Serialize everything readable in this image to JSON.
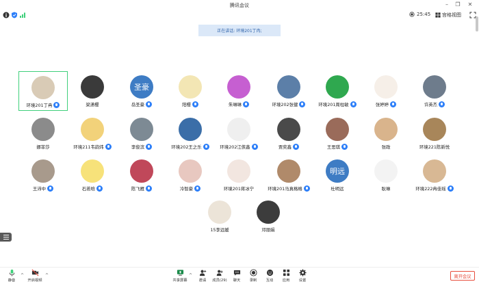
{
  "window": {
    "title": "腾讯会议"
  },
  "topbar": {
    "timer": "25:45",
    "view_label": "宫格视图"
  },
  "speaking": {
    "label": "正在讲话: 环境201丁冉;"
  },
  "colors": {
    "mic": "#2d7ff9",
    "active_border": "#3ecf7a",
    "leave": "#e74c3c",
    "avatar_text_bg": "#3e7cc4"
  },
  "participants": [
    {
      "name": "环境201丁冉",
      "avatar_text": "",
      "avatar_bg": "#d9cbb6",
      "mic": true
    },
    {
      "name": "梁潇樱",
      "avatar_text": "",
      "avatar_bg": "#3a3a3a",
      "mic": false
    },
    {
      "name": "岳圣豪",
      "avatar_text": "圣豪",
      "avatar_bg": "#3e7cc4",
      "mic": true
    },
    {
      "name": "阳樱",
      "avatar_text": "",
      "avatar_bg": "#f3e6b4",
      "mic": true
    },
    {
      "name": "朱琳琳",
      "avatar_text": "",
      "avatar_bg": "#c65fd1",
      "mic": true
    },
    {
      "name": "环境202张健",
      "avatar_text": "",
      "avatar_bg": "#5c7fa8",
      "mic": true
    },
    {
      "name": "环境201周柱敏",
      "avatar_text": "",
      "avatar_bg": "#2fa84f",
      "mic": true
    },
    {
      "name": "张婷婷",
      "avatar_text": "",
      "avatar_bg": "#f6efe8",
      "mic": true
    },
    {
      "name": "许英杰",
      "avatar_text": "",
      "avatar_bg": "#6e7c8c",
      "mic": true
    },
    {
      "name": "娜菲莎",
      "avatar_text": "",
      "avatar_bg": "#8b8b8b",
      "mic": false
    },
    {
      "name": "环境211韦韵炜",
      "avatar_text": "",
      "avatar_bg": "#f2d27a",
      "mic": true
    },
    {
      "name": "李俊滨",
      "avatar_text": "",
      "avatar_bg": "#7d8a94",
      "mic": true
    },
    {
      "name": "环境202王之乐",
      "avatar_text": "",
      "avatar_bg": "#3b6ea8",
      "mic": true
    },
    {
      "name": "环境202江俠鑫",
      "avatar_text": "",
      "avatar_bg": "#efefef",
      "mic": true
    },
    {
      "name": "贾奕鑫",
      "avatar_text": "",
      "avatar_bg": "#4a4a4a",
      "mic": true
    },
    {
      "name": "王思琪",
      "avatar_text": "",
      "avatar_bg": "#9a6b5a",
      "mic": true
    },
    {
      "name": "张政",
      "avatar_text": "",
      "avatar_bg": "#d9b48c",
      "mic": false
    },
    {
      "name": "环境221陈新悦",
      "avatar_text": "",
      "avatar_bg": "#a8865a",
      "mic": false
    },
    {
      "name": "王沛中",
      "avatar_text": "",
      "avatar_bg": "#a89a8c",
      "mic": true
    },
    {
      "name": "石若晗",
      "avatar_text": "",
      "avatar_bg": "#f7e27a",
      "mic": true
    },
    {
      "name": "陈飞雁",
      "avatar_text": "",
      "avatar_bg": "#c0485a",
      "mic": true
    },
    {
      "name": "冷智豪",
      "avatar_text": "",
      "avatar_bg": "#e8c8c0",
      "mic": true
    },
    {
      "name": "环境201蒋冰宁",
      "avatar_text": "",
      "avatar_bg": "#f2e6e0",
      "mic": false
    },
    {
      "name": "环境201马真格格",
      "avatar_text": "",
      "avatar_bg": "#b08a6a",
      "mic": true
    },
    {
      "name": "杜明远",
      "avatar_text": "明远",
      "avatar_bg": "#3e7cc4",
      "mic": false
    },
    {
      "name": "耿琳",
      "avatar_text": "",
      "avatar_bg": "#f3f3f3",
      "mic": false
    },
    {
      "name": "环境222冉佳瑶",
      "avatar_text": "",
      "avatar_bg": "#d8b894",
      "mic": true
    },
    {
      "name": "15李远媛",
      "avatar_text": "",
      "avatar_bg": "#ece4d8",
      "mic": false
    },
    {
      "name": "邓丽娟",
      "avatar_text": "",
      "avatar_bg": "#3c3c3c",
      "mic": false
    }
  ],
  "toolbar": {
    "mute": "静音",
    "video": "开启视频",
    "share": "共享屏幕",
    "invite": "邀请",
    "members": "成员(29)",
    "chat": "聊天",
    "record": "录制",
    "interact": "互动",
    "apps": "应用",
    "settings": "设置",
    "leave": "离开会议"
  }
}
